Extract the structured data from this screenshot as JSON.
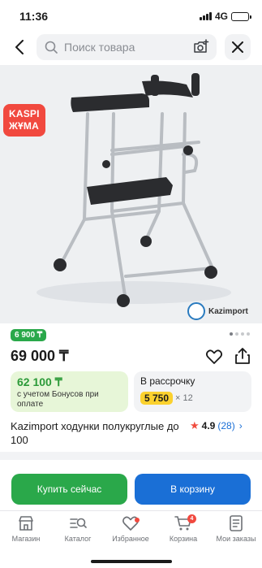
{
  "status": {
    "time": "11:36",
    "network": "4G",
    "battery_level": 0.8
  },
  "search": {
    "placeholder": "Поиск товара"
  },
  "image": {
    "promo_badge": {
      "line1": "KASPI",
      "line2": "ЖҰМА",
      "color": "#f1493f"
    },
    "brand_logo_text": "Kazimport",
    "carousel": {
      "total": 4,
      "active": 1
    }
  },
  "price": {
    "old_badge": "6 900 ₸",
    "current": "69 000 ₸"
  },
  "bonus": {
    "value": "62 100 ₸",
    "note": "с учетом Бонусов при оплате"
  },
  "installment": {
    "title": "В рассрочку",
    "amount": "5 750",
    "months": "× 12"
  },
  "product": {
    "title": "Kazimport ходунки полукруглые до 100",
    "rating": "4.9",
    "reviews": "(28)"
  },
  "actions": {
    "buy_now": "Купить сейчас",
    "to_cart": "В корзину"
  },
  "nav": {
    "items": [
      {
        "label": "Магазин",
        "icon": "shop-icon"
      },
      {
        "label": "Каталог",
        "icon": "catalog-icon"
      },
      {
        "label": "Избранное",
        "icon": "heart-icon"
      },
      {
        "label": "Корзина",
        "icon": "cart-icon",
        "badge": "4"
      },
      {
        "label": "Мои заказы",
        "icon": "orders-icon"
      }
    ]
  },
  "colors": {
    "green": "#2aa84a",
    "blue": "#1a6fd6",
    "red": "#f1493f",
    "yellow": "#fbd12e"
  }
}
